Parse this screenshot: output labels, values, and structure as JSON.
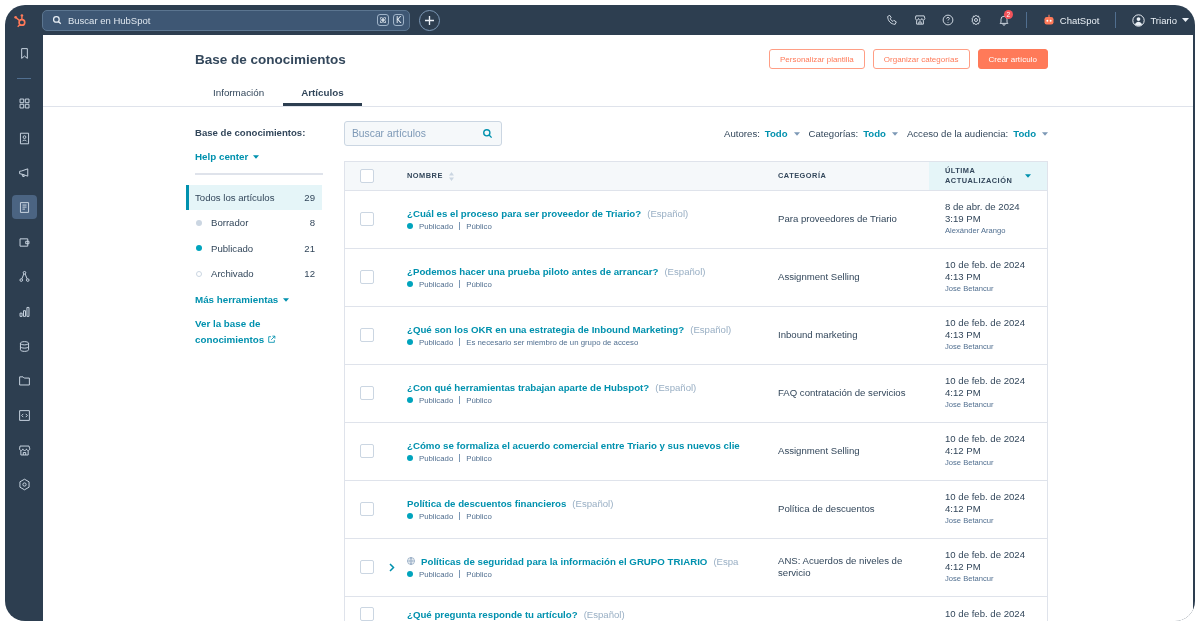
{
  "top_bar": {
    "search": {
      "placeholder": "Buscar en HubSpot",
      "shortcut_keys": [
        "⌘",
        "K"
      ]
    },
    "notifications": {
      "badge": "2"
    },
    "assistant": {
      "label": "ChatSpot"
    },
    "account": {
      "name": "Triario"
    }
  },
  "nav_sidebar": {
    "items": [
      {
        "selected": false
      },
      {
        "selected": false
      },
      {
        "selected": false
      },
      {
        "selected": false
      },
      {
        "selected": true
      },
      {
        "selected": false
      },
      {
        "selected": false
      },
      {
        "selected": false
      },
      {
        "selected": false
      },
      {
        "selected": false
      },
      {
        "selected": false
      },
      {
        "selected": false
      },
      {
        "selected": false
      }
    ]
  },
  "page": {
    "title": "Base de conocimientos",
    "buttons": [
      {
        "label": "Personalizar plantilla",
        "kind": "secondary"
      },
      {
        "label": "Organizar categorías",
        "kind": "secondary"
      },
      {
        "label": "Crear artículo",
        "kind": "primary"
      }
    ],
    "tabs": [
      {
        "label": "Información",
        "selected": false
      },
      {
        "label": "Artículos",
        "selected": true
      }
    ]
  },
  "filter_panel": {
    "heading": "Base de conocimientos:",
    "knowledge_base": "Help center",
    "statuses": [
      {
        "label": "Todos los artículos",
        "count": "29",
        "kind": "all",
        "selected": true
      },
      {
        "label": "Borrador",
        "count": "8",
        "kind": "dot",
        "color": "#cbd6e2",
        "selected": false
      },
      {
        "label": "Publicado",
        "count": "21",
        "kind": "dot",
        "color": "#00a4bd",
        "selected": false
      },
      {
        "label": "Archivado",
        "count": "12",
        "kind": "ring",
        "color": "#cbd6e2",
        "selected": false
      }
    ],
    "more_tools": "Más herramientas",
    "view_link": "Ver la base de conocimientos"
  },
  "toolbar": {
    "search": {
      "placeholder": "Buscar artículos"
    },
    "filters": [
      {
        "label": "Autores:",
        "value": "Todo"
      },
      {
        "label": "Categorías:",
        "value": "Todo"
      },
      {
        "label": "Acceso de la audiencia:",
        "value": "Todo"
      }
    ]
  },
  "table": {
    "select_all": {
      "checked": false
    },
    "columns": [
      {
        "label": "NOMBRE",
        "sortable": true,
        "sorted": false
      },
      {
        "label": "CATEGORÍA",
        "sortable": false,
        "sorted": false
      },
      {
        "label": "ÚLTIMA ACTUALIZACIÓN",
        "sortable": true,
        "sorted": true
      }
    ],
    "rows": [
      {
        "checked": false,
        "expandable": false,
        "title": "¿Cuál es el proceso para ser proveedor de Triario?",
        "language": "(Español)",
        "status": "Publicado",
        "access": "Público",
        "category": "Para proveedores de Triario",
        "date": "8 de abr. de 2024",
        "time": "3:19 PM",
        "author": "Alexánder Arango"
      },
      {
        "checked": false,
        "expandable": false,
        "title": "¿Podemos hacer una prueba piloto antes de arrancar?",
        "language": "(Español)",
        "status": "Publicado",
        "access": "Público",
        "category": "Assignment Selling",
        "date": "10 de feb. de 2024",
        "time": "4:13 PM",
        "author": "Jose Betancur"
      },
      {
        "checked": false,
        "expandable": false,
        "title": "¿Qué son los OKR en una estrategia de Inbound Marketing?",
        "language": "(Español)",
        "status": "Publicado",
        "access": "Es necesario ser miembro de un grupo de acceso",
        "category": "Inbound marketing",
        "date": "10 de feb. de 2024",
        "time": "4:13 PM",
        "author": "Jose Betancur"
      },
      {
        "checked": false,
        "expandable": false,
        "title": "¿Con qué herramientas trabajan aparte de Hubspot?",
        "language": "(Español)",
        "status": "Publicado",
        "access": "Público",
        "category": "FAQ contratación de servicios",
        "date": "10 de feb. de 2024",
        "time": "4:12 PM",
        "author": "Jose Betancur"
      },
      {
        "checked": false,
        "expandable": false,
        "title": "¿Cómo se formaliza el acuerdo comercial entre Triario y sus nuevos clie",
        "status": "Publicado",
        "access": "Público",
        "category": "Assignment Selling",
        "date": "10 de feb. de 2024",
        "time": "4:12 PM",
        "author": "Jose Betancur"
      },
      {
        "checked": false,
        "expandable": false,
        "title": "Política de descuentos financieros",
        "language": "(Español)",
        "status": "Publicado",
        "access": "Público",
        "category": "Política de descuentos",
        "date": "10 de feb. de 2024",
        "time": "4:12 PM",
        "author": "Jose Betancur"
      },
      {
        "checked": false,
        "expandable": true,
        "title": "Políticas de seguridad para la información el GRUPO TRIARIO",
        "language": "(Espa",
        "status": "Publicado",
        "access": "Público",
        "category": "ANS: Acuerdos de niveles de servicio",
        "date": "10 de feb. de 2024",
        "time": "4:12 PM",
        "author": "Jose Betancur"
      },
      {
        "checked": false,
        "expandable": false,
        "title": "¿Qué pregunta responde tu artículo?",
        "language": "(Español)",
        "date": "10 de feb. de 2024"
      }
    ]
  }
}
